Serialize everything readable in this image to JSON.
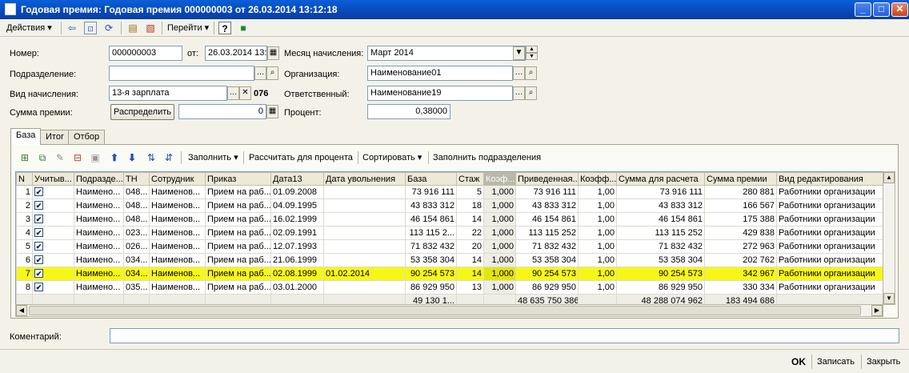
{
  "window": {
    "title": "Годовая премия: Годовая премия 000000003 от 26.03.2014 13:12:18",
    "min_glyph": "_",
    "max_glyph": "□",
    "close_glyph": "✕"
  },
  "toolbar": {
    "actions_label": "Действия",
    "goto_label": "Перейти",
    "help_label": "?"
  },
  "form": {
    "number_label": "Номер:",
    "number_value": "000000003",
    "date_label": "от:",
    "date_value": "26.03.2014 13:",
    "month_label": "Месяц начисления:",
    "month_value": "Март 2014",
    "division_label": "Подразделение:",
    "division_value": "",
    "org_label": "Организация:",
    "org_value": "Наименование01",
    "accrual_label": "Вид начисления:",
    "accrual_value": "13-я зарплата",
    "accrual_code": "076",
    "responsible_label": "Ответственный:",
    "responsible_value": "Наименование19",
    "sum_label": "Сумма премии:",
    "distribute_label": "Распределить",
    "sum_value": "0",
    "percent_label": "Процент:",
    "percent_value": "0,38000",
    "comment_label": "Коментарий:",
    "comment_value": ""
  },
  "tabs": [
    "База",
    "Итог",
    "Отбор"
  ],
  "grid_toolbar": {
    "fill_label": "Заполнить",
    "calc_label": "Рассчитать для процента",
    "sort_label": "Сортировать",
    "fill_div_label": "Заполнить подразделения"
  },
  "columns": [
    "N",
    "Учитыв...",
    "Подразде...",
    "ТН",
    "Сотрудник",
    "Приказ",
    "Дата13",
    "Дата увольнения",
    "База",
    "Стаж",
    "Коэф...",
    "Приведенная...",
    "Коэфф...",
    "Сумма для расчета",
    "Сумма премии",
    "Вид редактирования"
  ],
  "rows": [
    {
      "n": "1",
      "chk": true,
      "div": "Наимено...",
      "tn": "048...",
      "emp": "Наименов...",
      "order": "Прием на раб...",
      "d13": "01.09.2008",
      "dism": "",
      "base": "73 916 111",
      "exp": "5",
      "k1": "1,000",
      "red": "73 916 111",
      "k2": "1,00",
      "sumc": "73 916 111",
      "bonus": "280 881",
      "edit": "Работники организации"
    },
    {
      "n": "2",
      "chk": true,
      "div": "Наимено...",
      "tn": "048...",
      "emp": "Наименов...",
      "order": "Прием на раб...",
      "d13": "04.09.1995",
      "dism": "",
      "base": "43 833 312",
      "exp": "18",
      "k1": "1,000",
      "red": "43 833 312",
      "k2": "1,00",
      "sumc": "43 833 312",
      "bonus": "166 567",
      "edit": "Работники организации"
    },
    {
      "n": "3",
      "chk": true,
      "div": "Наимено...",
      "tn": "048...",
      "emp": "Наименов...",
      "order": "Прием на раб...",
      "d13": "16.02.1999",
      "dism": "",
      "base": "46 154 861",
      "exp": "14",
      "k1": "1,000",
      "red": "46 154 861",
      "k2": "1,00",
      "sumc": "46 154 861",
      "bonus": "175 388",
      "edit": "Работники организации"
    },
    {
      "n": "4",
      "chk": true,
      "div": "Наимено...",
      "tn": "023...",
      "emp": "Наименов...",
      "order": "Прием на раб...",
      "d13": "02.09.1991",
      "dism": "",
      "base": "113 115 2...",
      "exp": "22",
      "k1": "1,000",
      "red": "113 115 252",
      "k2": "1,00",
      "sumc": "113 115 252",
      "bonus": "429 838",
      "edit": "Работники организации"
    },
    {
      "n": "5",
      "chk": true,
      "div": "Наимено...",
      "tn": "026...",
      "emp": "Наименов...",
      "order": "Прием на раб...",
      "d13": "12.07.1993",
      "dism": "",
      "base": "71 832 432",
      "exp": "20",
      "k1": "1,000",
      "red": "71 832 432",
      "k2": "1,00",
      "sumc": "71 832 432",
      "bonus": "272 963",
      "edit": "Работники организации"
    },
    {
      "n": "6",
      "chk": true,
      "div": "Наимено...",
      "tn": "034...",
      "emp": "Наименов...",
      "order": "Прием на раб...",
      "d13": "21.06.1999",
      "dism": "",
      "base": "53 358 304",
      "exp": "14",
      "k1": "1,000",
      "red": "53 358 304",
      "k2": "1,00",
      "sumc": "53 358 304",
      "bonus": "202 762",
      "edit": "Работники организации"
    },
    {
      "n": "7",
      "chk": true,
      "div": "Наимено...",
      "tn": "034...",
      "emp": "Наименов...",
      "order": "Прием на раб...",
      "d13": "02.08.1999",
      "dism": "01.02.2014",
      "base": "90 254 573",
      "exp": "14",
      "k1": "1,000",
      "red": "90 254 573",
      "k2": "1,00",
      "sumc": "90 254 573",
      "bonus": "342 967",
      "edit": "Работники организации"
    },
    {
      "n": "8",
      "chk": true,
      "div": "Наимено...",
      "tn": "035...",
      "emp": "Наименов...",
      "order": "Прием на раб...",
      "d13": "03.01.2000",
      "dism": "",
      "base": "86 929 950",
      "exp": "13",
      "k1": "1,000",
      "red": "86 929 950",
      "k2": "1,00",
      "sumc": "86 929 950",
      "bonus": "330 334",
      "edit": "Работники организации"
    }
  ],
  "totals": {
    "base": "49 130 1...",
    "red": "48 635 750 386",
    "sumc": "48 288 074 962",
    "bonus": "183 494 686"
  },
  "selected_row": 7,
  "bottom": {
    "ok": "OK",
    "save": "Записать",
    "close": "Закрыть"
  }
}
